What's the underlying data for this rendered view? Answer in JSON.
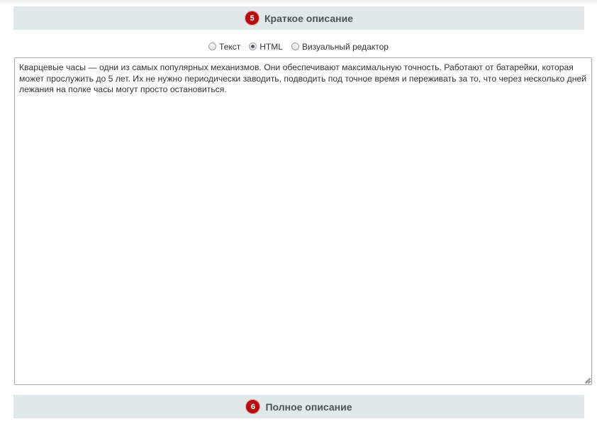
{
  "sections": {
    "short": {
      "number": "5",
      "title": "Краткое описание"
    },
    "full": {
      "number": "6",
      "title": "Полное описание"
    }
  },
  "editor_modes": [
    {
      "label": "Текст",
      "checked": false
    },
    {
      "label": "HTML",
      "checked": true
    },
    {
      "label": "Визуальный редактор",
      "checked": false
    }
  ],
  "editor": {
    "value": "Кварцевые часы — одни из самых популярных механизмов. Они обеспечивают максимальную точность. Работают от батарейки, которая может прослужить до 5 лет. Их не нужно периодически заводить, подводить под точное время и переживать за то, что через несколько дней лежания на полке часы могут просто остановиться."
  },
  "colors": {
    "header_bg": "#e1e8e9",
    "badge": "#b50e0e",
    "title_text": "#4b5457"
  }
}
